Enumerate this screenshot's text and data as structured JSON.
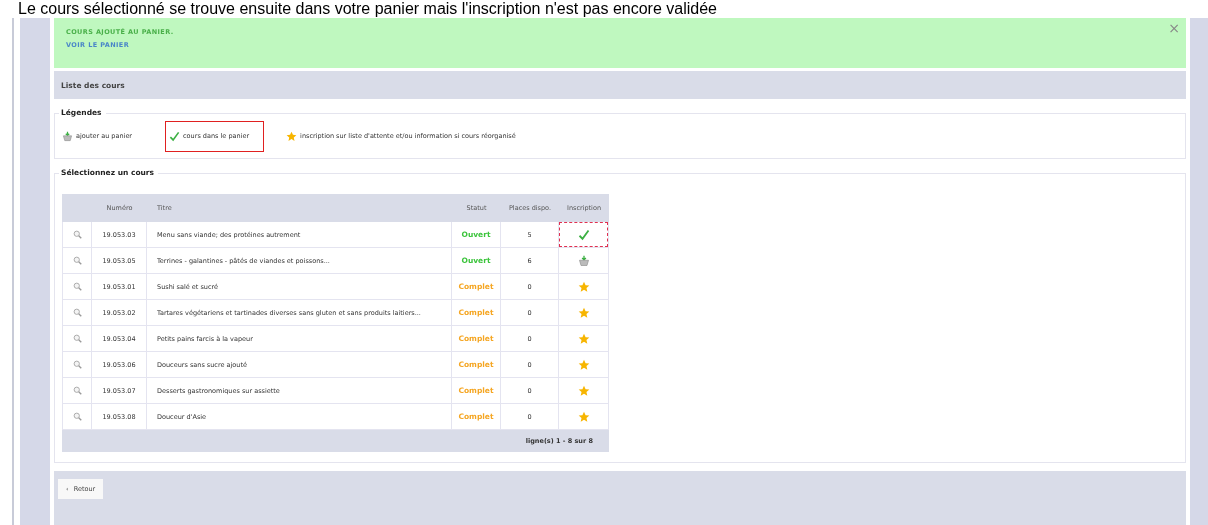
{
  "caption": "Le cours sélectionné se trouve ensuite dans votre panier mais l'inscription n'est pas encore validée",
  "alert": {
    "message": "COURS AJOUTÉ AU PANIER.",
    "link": "VOIR LE PANIER",
    "close": "×"
  },
  "section_title": "Liste des cours",
  "legend": {
    "title": "Légendes",
    "items": [
      {
        "kind": "add",
        "label": "ajouter au panier",
        "highlighted": false
      },
      {
        "kind": "in_cart",
        "label": "cours dans le panier",
        "highlighted": true
      },
      {
        "kind": "waitlist",
        "label": "inscription sur liste d'attente et/ou information si cours réorganisé",
        "highlighted": false
      }
    ]
  },
  "courses": {
    "title": "Sélectionnez un cours",
    "columns": [
      "Numéro",
      "Titre",
      "Statut",
      "Places dispo.",
      "Inscription"
    ],
    "rows": [
      {
        "number": "19.053.03",
        "title": "Menu sans viande; des protéines autrement",
        "status": "Ouvert",
        "color": "#3cc43c",
        "places": "5",
        "inscription": {
          "kind": "in_cart",
          "highlighted": true
        }
      },
      {
        "number": "19.053.05",
        "title": "Terrines - galantines - pâtés de viandes et poissons...",
        "status": "Ouvert",
        "color": "#3cc43c",
        "places": "6",
        "inscription": {
          "kind": "add",
          "highlighted": false
        }
      },
      {
        "number": "19.053.01",
        "title": "Sushi salé et sucré",
        "status": "Complet",
        "color": "#f5a623",
        "places": "0",
        "inscription": {
          "kind": "waitlist",
          "highlighted": false
        }
      },
      {
        "number": "19.053.02",
        "title": "Tartares végétariens et tartinades diverses sans gluten et sans produits laitiers...",
        "status": "Complet",
        "color": "#f5a623",
        "places": "0",
        "inscription": {
          "kind": "waitlist",
          "highlighted": false
        }
      },
      {
        "number": "19.053.04",
        "title": "Petits pains farcis à la vapeur",
        "status": "Complet",
        "color": "#f5a623",
        "places": "0",
        "inscription": {
          "kind": "waitlist",
          "highlighted": false
        }
      },
      {
        "number": "19.053.06",
        "title": "Douceurs sans sucre ajouté",
        "status": "Complet",
        "color": "#f5a623",
        "places": "0",
        "inscription": {
          "kind": "waitlist",
          "highlighted": false
        }
      },
      {
        "number": "19.053.07",
        "title": "Desserts gastronomiques sur assiette",
        "status": "Complet",
        "color": "#f5a623",
        "places": "0",
        "inscription": {
          "kind": "waitlist",
          "highlighted": false
        }
      },
      {
        "number": "19.053.08",
        "title": "Douceur d'Asie",
        "status": "Complet",
        "color": "#f5a623",
        "places": "0",
        "inscription": {
          "kind": "waitlist",
          "highlighted": false
        }
      }
    ],
    "footer": "ligne(s) 1 - 8 sur 8"
  },
  "back_button": {
    "icon": "‹",
    "label": "Retour"
  }
}
